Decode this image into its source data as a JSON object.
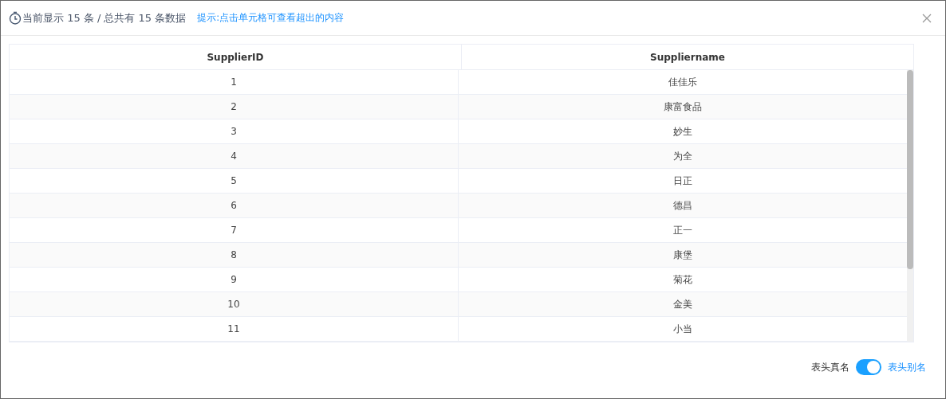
{
  "header": {
    "summary": "当前显示 15 条 / 总共有 15 条数据",
    "hint": "提示:点击单元格可查看超出的内容"
  },
  "table": {
    "columns": [
      "SupplierID",
      "Suppliername"
    ],
    "rows": [
      [
        "1",
        "佳佳乐"
      ],
      [
        "2",
        "康富食品"
      ],
      [
        "3",
        "妙生"
      ],
      [
        "4",
        "为全"
      ],
      [
        "5",
        "日正"
      ],
      [
        "6",
        "德昌"
      ],
      [
        "7",
        "正一"
      ],
      [
        "8",
        "康堡"
      ],
      [
        "9",
        "菊花"
      ],
      [
        "10",
        "金美"
      ],
      [
        "11",
        "小当"
      ]
    ]
  },
  "footer": {
    "left_label": "表头真名",
    "right_label": "表头别名",
    "switch_on": true
  }
}
